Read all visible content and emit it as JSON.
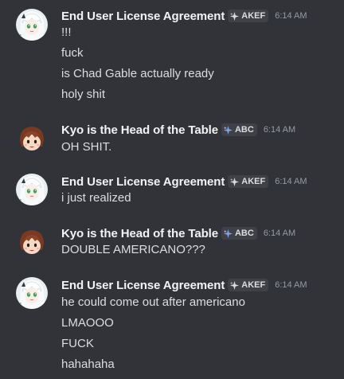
{
  "colors": {
    "background": "#313338",
    "username": "#f2f3f5",
    "text": "#dbdee1",
    "timestamp": "#949ba4",
    "tag_bg": "#3f4147"
  },
  "groups": [
    {
      "avatar_icon": "anime-girl-avatar-icon",
      "username": "End User License Agreement",
      "tag": "AKEF",
      "tag_icon": "sparkle-icon",
      "time": "6:14 AM",
      "messages": [
        "!!!",
        "fuck",
        "is Chad Gable actually ready",
        "holy shit"
      ]
    },
    {
      "avatar_icon": "brown-hair-character-avatar-icon",
      "username": "Kyo is the Head of the Table",
      "tag": "ABC",
      "tag_icon": "sparkle-icon",
      "time": "6:14 AM",
      "messages": [
        "OH SHIT."
      ]
    },
    {
      "avatar_icon": "anime-girl-avatar-icon",
      "username": "End User License Agreement",
      "tag": "AKEF",
      "tag_icon": "sparkle-icon",
      "time": "6:14 AM",
      "messages": [
        "i just realized"
      ]
    },
    {
      "avatar_icon": "brown-hair-character-avatar-icon",
      "username": "Kyo is the Head of the Table",
      "tag": "ABC",
      "tag_icon": "sparkle-icon",
      "time": "6:14 AM",
      "messages": [
        "DOUBLE AMERICANO???"
      ]
    },
    {
      "avatar_icon": "anime-girl-avatar-icon",
      "username": "End User License Agreement",
      "tag": "AKEF",
      "tag_icon": "sparkle-icon",
      "time": "6:14 AM",
      "messages": [
        "he could come out after americano",
        "LMAOOO",
        "FUCK",
        "hahahaha"
      ]
    }
  ]
}
